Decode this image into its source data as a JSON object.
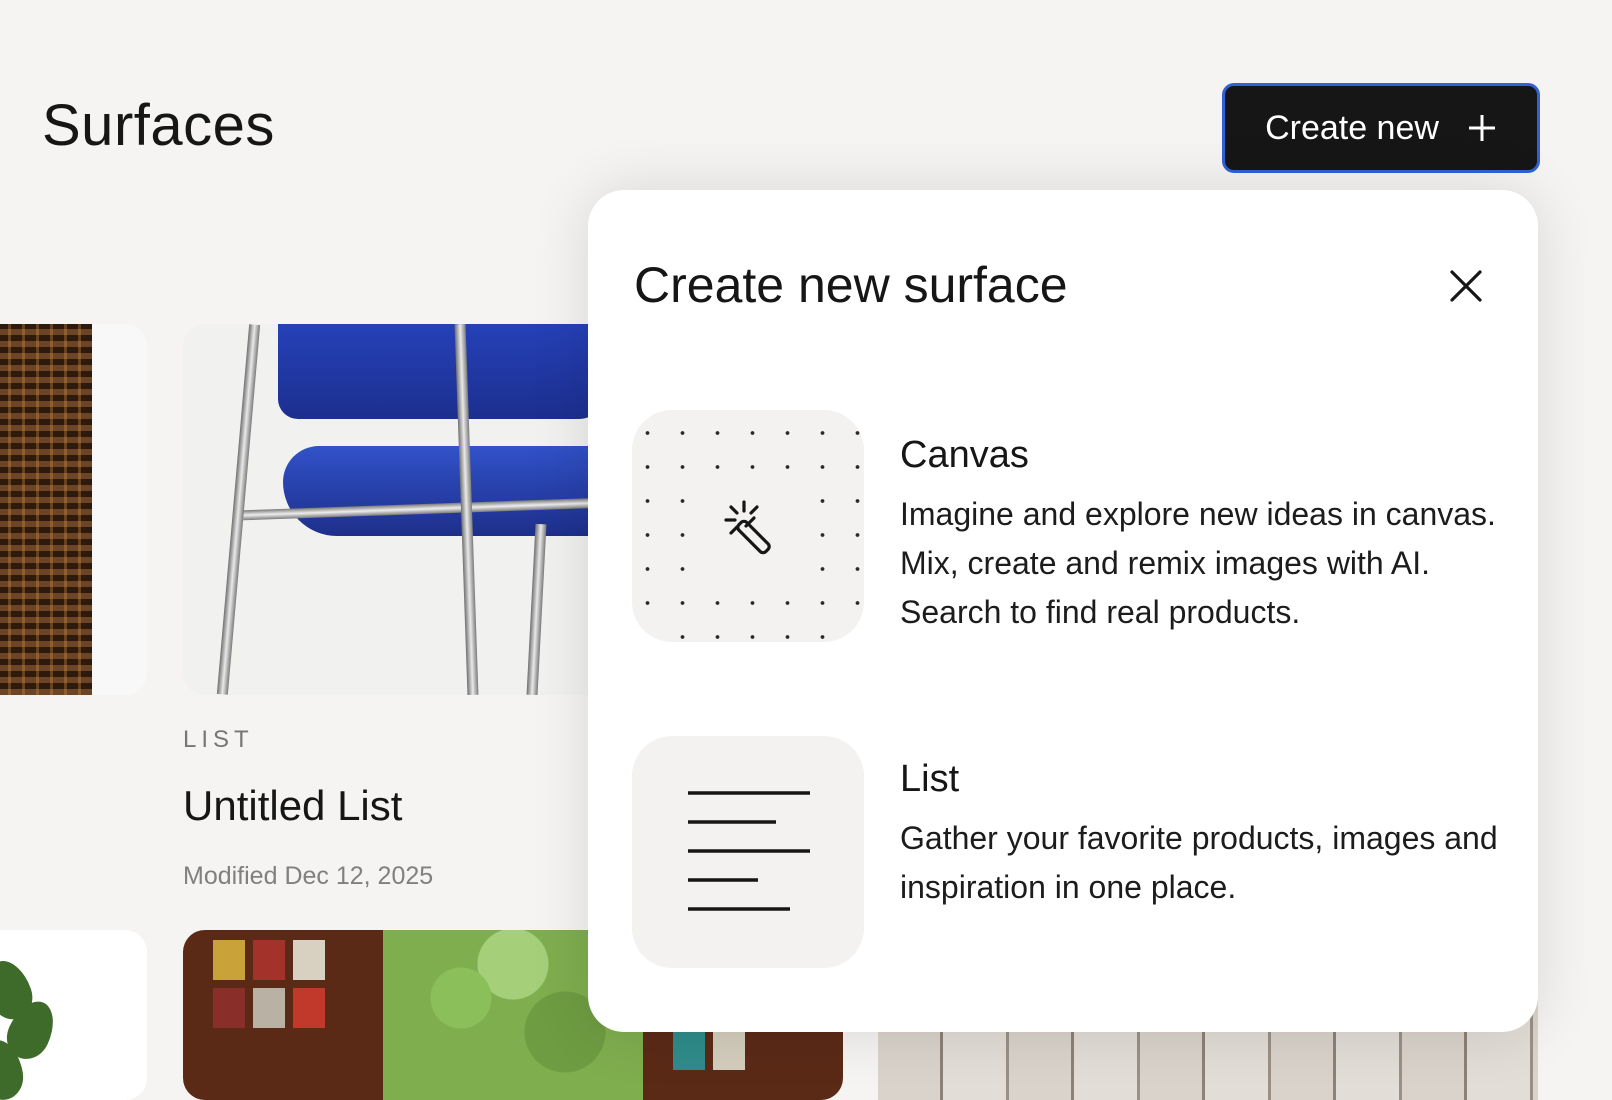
{
  "header": {
    "title": "Surfaces",
    "create_button_label": "Create new"
  },
  "cards": [
    {
      "label": "LIST",
      "title": "Untitled List",
      "modified": "Modified Dec 12, 2025"
    }
  ],
  "modal": {
    "title": "Create new surface",
    "options": [
      {
        "name": "Canvas",
        "description": "Imagine and explore new ideas in canvas. Mix, create and remix images with AI. Search to find real products.",
        "icon": "magic-wand-icon"
      },
      {
        "name": "List",
        "description": "Gather your favorite products, images and inspiration in one place.",
        "icon": "text-lines-icon"
      }
    ]
  },
  "colors": {
    "background": "#f5f4f2",
    "button_bg": "#161616",
    "button_focus_ring": "#2f62d6",
    "modal_bg": "#ffffff",
    "tile_bg": "#f3f2f0"
  }
}
